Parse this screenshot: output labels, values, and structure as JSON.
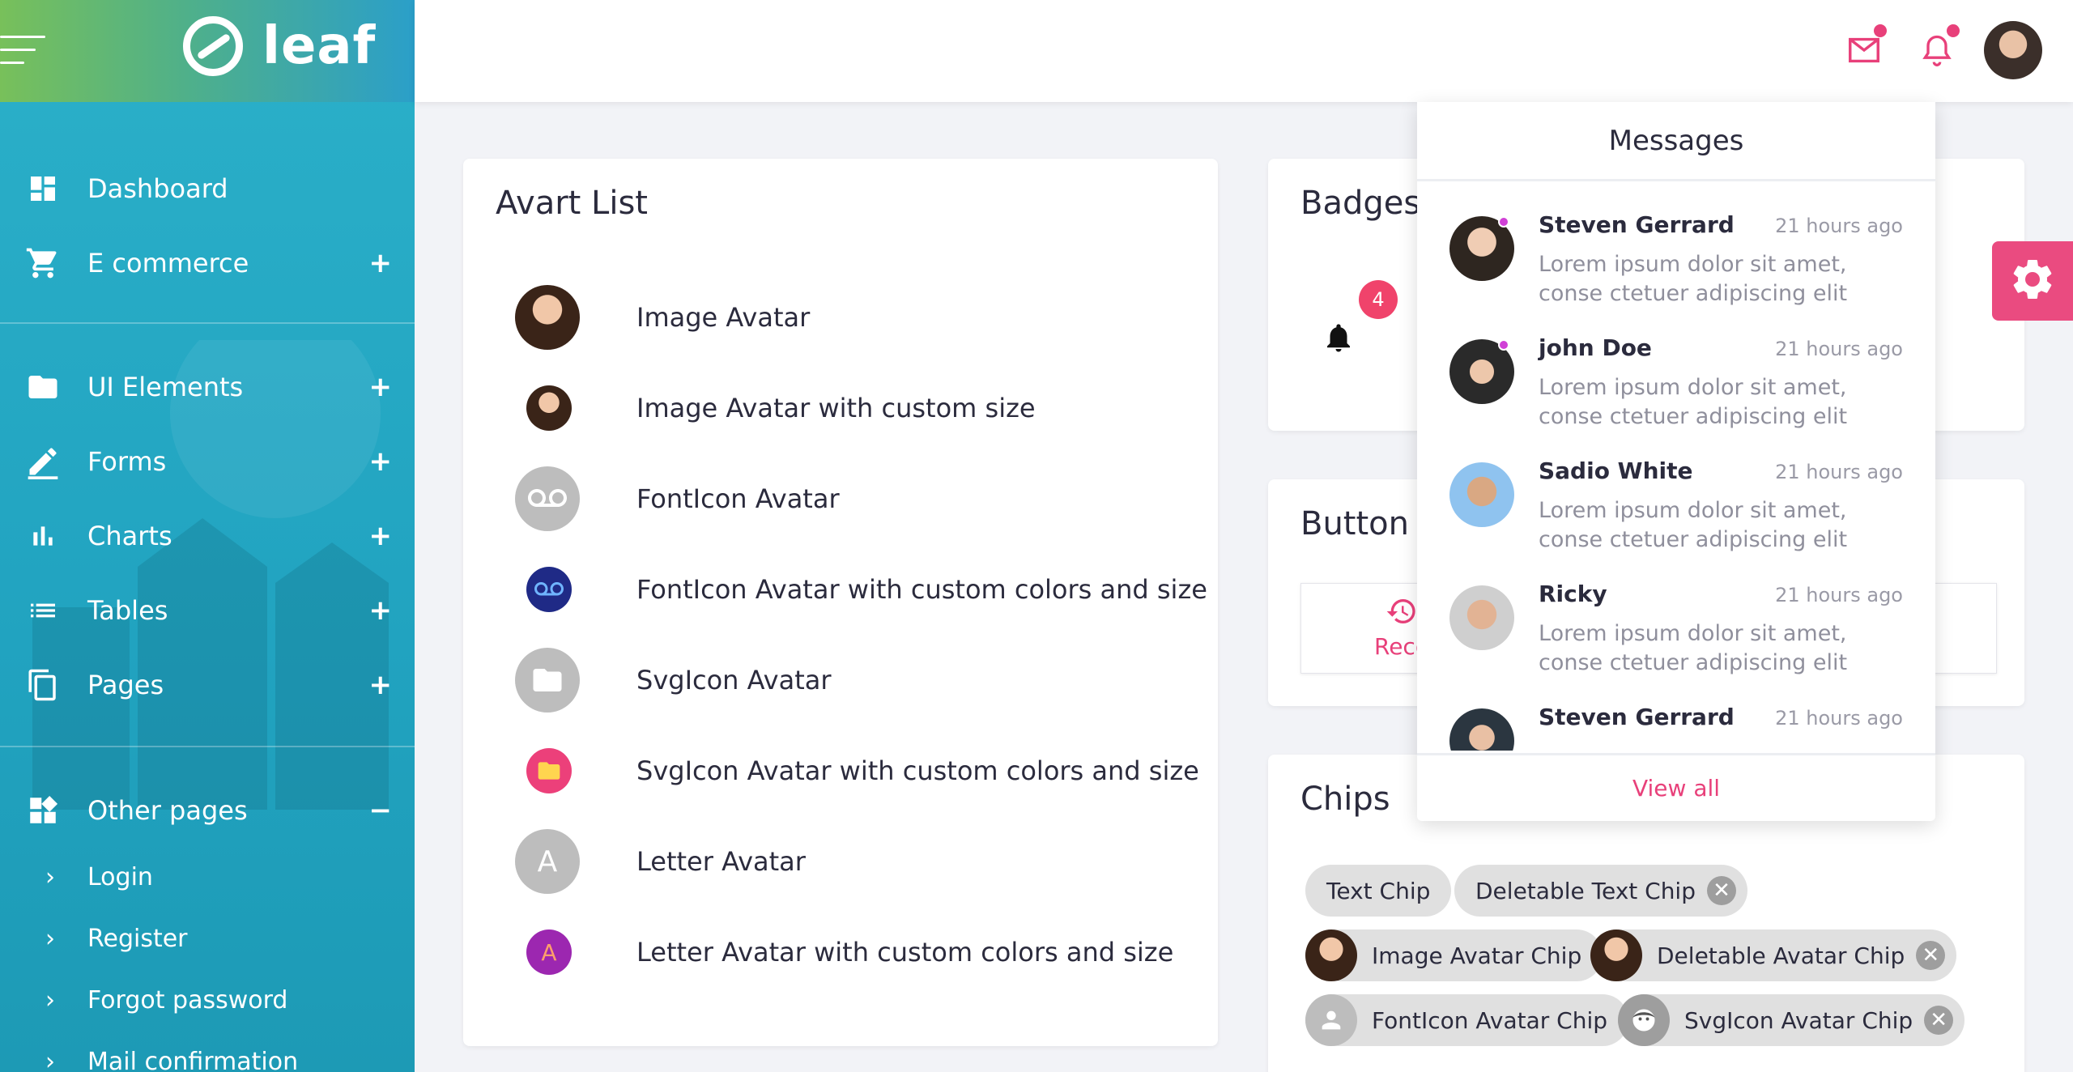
{
  "brand": {
    "name": "leaf"
  },
  "sidebar": {
    "items": [
      {
        "label": "Dashboard",
        "icon": "dashboard-icon"
      },
      {
        "label": "E commerce",
        "icon": "cart-icon",
        "expand": "+"
      },
      {
        "label": "UI Elements",
        "icon": "folder-icon",
        "expand": "+"
      },
      {
        "label": "Forms",
        "icon": "pencil-icon",
        "expand": "+"
      },
      {
        "label": "Charts",
        "icon": "bar-chart-icon",
        "expand": "+"
      },
      {
        "label": "Tables",
        "icon": "list-icon",
        "expand": "+"
      },
      {
        "label": "Pages",
        "icon": "pages-icon",
        "expand": "+"
      },
      {
        "label": "Other pages",
        "icon": "widgets-icon",
        "expand": "−"
      }
    ],
    "subitems": [
      {
        "label": "Login"
      },
      {
        "label": "Register"
      },
      {
        "label": "Forgot password"
      },
      {
        "label": "Mail confirmation"
      }
    ]
  },
  "topbar": {
    "mail_icon": "mail-icon",
    "bell_icon": "bell-icon",
    "accent": "#e8407a"
  },
  "avatar_list": {
    "title": "Avart List",
    "items": [
      {
        "label": "Image Avatar"
      },
      {
        "label": "Image Avatar with custom size"
      },
      {
        "label": "FontIcon Avatar"
      },
      {
        "label": "FontIcon Avatar with custom colors and size"
      },
      {
        "label": "SvgIcon Avatar"
      },
      {
        "label": "SvgIcon Avatar with custom colors and size"
      },
      {
        "label": "Letter Avatar",
        "letter": "A"
      },
      {
        "label": "Letter Avatar with custom colors and size",
        "letter": "A"
      }
    ]
  },
  "badges": {
    "title": "Badges",
    "count": "4"
  },
  "button_card": {
    "title": "Button N",
    "button_label": "Reco"
  },
  "chips": {
    "title": "Chips",
    "items": [
      {
        "label": "Text Chip"
      },
      {
        "label": "Deletable Text Chip"
      },
      {
        "label": "Image Avatar Chip"
      },
      {
        "label": "Deletable Avatar Chip"
      },
      {
        "label": "FontIcon Avatar Chip"
      },
      {
        "label": "SvgIcon Avatar Chip"
      }
    ],
    "delete_symbol": "✕"
  },
  "messages": {
    "title": "Messages",
    "items": [
      {
        "name": "Steven Gerrard",
        "time": "21 hours ago",
        "text": "Lorem ipsum dolor sit amet, conse ctetuer adipiscing elit"
      },
      {
        "name": "john Doe",
        "time": "21 hours ago",
        "text": "Lorem ipsum dolor sit amet, conse ctetuer adipiscing elit"
      },
      {
        "name": "Sadio White",
        "time": "21 hours ago",
        "text": "Lorem ipsum dolor sit amet, conse ctetuer adipiscing elit"
      },
      {
        "name": "Ricky",
        "time": "21 hours ago",
        "text": "Lorem ipsum dolor sit amet, conse ctetuer adipiscing elit"
      },
      {
        "name": "Steven Gerrard",
        "time": "21 hours ago",
        "text": ""
      }
    ],
    "view_all": "View all"
  }
}
